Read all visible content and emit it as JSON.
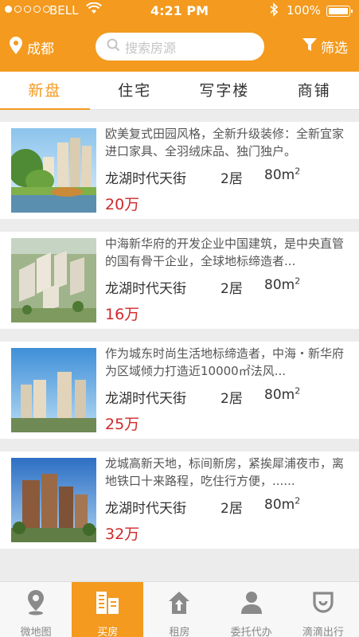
{
  "status_bar": {
    "carrier": "BELL",
    "time": "4:21 PM",
    "battery": "100%"
  },
  "header": {
    "city": "成都",
    "search_placeholder": "搜索房源",
    "filter_label": "筛选"
  },
  "tabs": [
    {
      "label": "新盘",
      "active": true
    },
    {
      "label": "住宅",
      "active": false
    },
    {
      "label": "写字楼",
      "active": false
    },
    {
      "label": "商铺",
      "active": false
    }
  ],
  "listings": [
    {
      "description": "欧美复式田园风格，全新升级装修：全新宜家进口家具、全羽绒床品、独门独户。",
      "name": "龙湖时代天街",
      "rooms": "2居",
      "area": "80m",
      "area_unit_sup": "2",
      "price": "20万"
    },
    {
      "description": "中海新华府的开发企业中国建筑，是中央直管的国有骨干企业，全球地标缔造者...",
      "name": "龙湖时代天街",
      "rooms": "2居",
      "area": "80m",
      "area_unit_sup": "2",
      "price": "16万"
    },
    {
      "description": "作为城东时尚生活地标缔造者，中海・新华府为区域倾力打造近10000㎡法风...",
      "name": "龙湖时代天街",
      "rooms": "2居",
      "area": "80m",
      "area_unit_sup": "2",
      "price": "25万"
    },
    {
      "description": "龙城高新天地，标间新房，紧挨犀浦夜市，离地铁口十来路程，吃住行方便，......",
      "name": "龙湖时代天街",
      "rooms": "2居",
      "area": "80m",
      "area_unit_sup": "2",
      "price": "32万"
    }
  ],
  "bottom_nav": [
    {
      "label": "微地图",
      "icon": "map-pin-icon",
      "active": false
    },
    {
      "label": "买房",
      "icon": "buildings-icon",
      "active": true
    },
    {
      "label": "租房",
      "icon": "house-up-icon",
      "active": false
    },
    {
      "label": "委托代办",
      "icon": "person-icon",
      "active": false
    },
    {
      "label": "滴滴出行",
      "icon": "didi-icon",
      "active": false
    }
  ],
  "colors": {
    "accent": "#f39a1f",
    "price": "#d0282a"
  }
}
